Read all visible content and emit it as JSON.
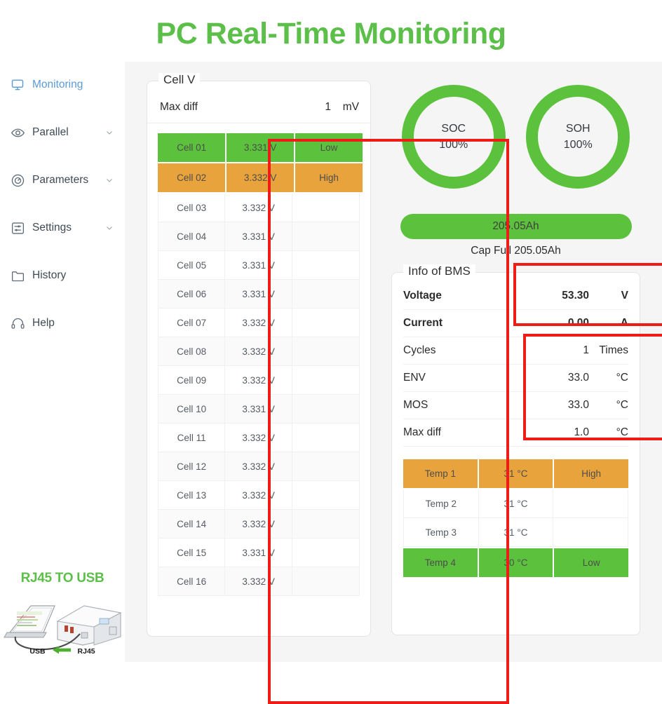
{
  "header": {
    "title": "PC Real-Time Monitoring"
  },
  "sidebar": {
    "items": [
      {
        "label": "Monitoring",
        "icon": "monitor-icon",
        "active": true,
        "chevron": false
      },
      {
        "label": "Parallel",
        "icon": "eye-icon",
        "active": false,
        "chevron": true
      },
      {
        "label": "Parameters",
        "icon": "gauge-icon",
        "active": false,
        "chevron": true
      },
      {
        "label": "Settings",
        "icon": "sliders-icon",
        "active": false,
        "chevron": true
      },
      {
        "label": "History",
        "icon": "folder-icon",
        "active": false,
        "chevron": false
      },
      {
        "label": "Help",
        "icon": "headset-icon",
        "active": false,
        "chevron": false
      }
    ],
    "promo": {
      "title": "RJ45 TO USB",
      "left_label": "USB",
      "right_label": "RJ45",
      "arrow": "left-arrow-icon"
    }
  },
  "cell_panel": {
    "legend": "Cell V",
    "max_diff": {
      "label": "Max diff",
      "value": "1",
      "unit": "mV"
    },
    "rows": [
      {
        "name": "Cell 01",
        "voltage": "3.331 V",
        "tag": "Low",
        "state": "green"
      },
      {
        "name": "Cell 02",
        "voltage": "3.332 V",
        "tag": "High",
        "state": "orange"
      },
      {
        "name": "Cell 03",
        "voltage": "3.332 V",
        "tag": "",
        "state": "plain"
      },
      {
        "name": "Cell 04",
        "voltage": "3.331 V",
        "tag": "",
        "state": "alt"
      },
      {
        "name": "Cell 05",
        "voltage": "3.331 V",
        "tag": "",
        "state": "plain"
      },
      {
        "name": "Cell 06",
        "voltage": "3.331 V",
        "tag": "",
        "state": "alt"
      },
      {
        "name": "Cell 07",
        "voltage": "3.332 V",
        "tag": "",
        "state": "plain"
      },
      {
        "name": "Cell 08",
        "voltage": "3.332 V",
        "tag": "",
        "state": "alt"
      },
      {
        "name": "Cell 09",
        "voltage": "3.332 V",
        "tag": "",
        "state": "plain"
      },
      {
        "name": "Cell 10",
        "voltage": "3.331 V",
        "tag": "",
        "state": "alt"
      },
      {
        "name": "Cell 11",
        "voltage": "3.332 V",
        "tag": "",
        "state": "plain"
      },
      {
        "name": "Cell 12",
        "voltage": "3.332 V",
        "tag": "",
        "state": "alt"
      },
      {
        "name": "Cell 13",
        "voltage": "3.332 V",
        "tag": "",
        "state": "plain"
      },
      {
        "name": "Cell 14",
        "voltage": "3.332 V",
        "tag": "",
        "state": "alt"
      },
      {
        "name": "Cell 15",
        "voltage": "3.331 V",
        "tag": "",
        "state": "plain"
      },
      {
        "name": "Cell 16",
        "voltage": "3.332 V",
        "tag": "",
        "state": "alt"
      }
    ]
  },
  "gauges": [
    {
      "label": "SOC",
      "value": "100%",
      "percent": 100,
      "color": "#5cc13c"
    },
    {
      "label": "SOH",
      "value": "100%",
      "percent": 100,
      "color": "#5cc13c"
    }
  ],
  "capacity": {
    "bar_label": "205.05Ah",
    "percent": 100,
    "sub_label": "Cap Full  205.05Ah",
    "color": "#5cc13c"
  },
  "bms_panel": {
    "legend": "Info of BMS",
    "rows": [
      {
        "label": "Voltage",
        "value": "53.30",
        "unit": "V",
        "bold": true
      },
      {
        "label": "Current",
        "value": "0.00",
        "unit": "A",
        "bold": true
      },
      {
        "label": "Cycles",
        "value": "1",
        "unit": "Times",
        "bold": false
      },
      {
        "label": "ENV",
        "value": "33.0",
        "unit": "°C",
        "bold": false
      },
      {
        "label": "MOS",
        "value": "33.0",
        "unit": "°C",
        "bold": false
      },
      {
        "label": "Max diff",
        "value": "1.0",
        "unit": "°C",
        "bold": false
      }
    ],
    "temps": [
      {
        "name": "Temp 1",
        "value": "31 °C",
        "tag": "High",
        "state": "orange"
      },
      {
        "name": "Temp 2",
        "value": "31 °C",
        "tag": "",
        "state": "plain"
      },
      {
        "name": "Temp 3",
        "value": "31 °C",
        "tag": "",
        "state": "plain"
      },
      {
        "name": "Temp 4",
        "value": "30 °C",
        "tag": "Low",
        "state": "green"
      }
    ]
  },
  "annotations": [
    {
      "name": "cell-v-highlight",
      "color": "#ee1c16"
    },
    {
      "name": "capacity-highlight",
      "color": "#ee1c16"
    },
    {
      "name": "bms-info-highlight",
      "color": "#ee1c16"
    }
  ],
  "colors": {
    "accent_green": "#5cc13c",
    "title_green": "#5bbf4a",
    "warn_orange": "#e8a33d",
    "active_blue": "#5b9bd5",
    "annotation_red": "#ee1c16",
    "panel_bg": "#f5f5f5"
  }
}
